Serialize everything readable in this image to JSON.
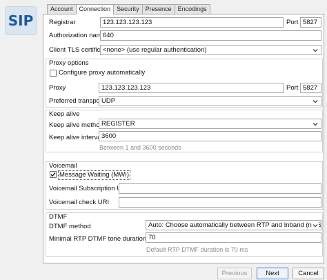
{
  "logo": {
    "text": "SIP"
  },
  "tabs": [
    {
      "label": "Account",
      "active": false
    },
    {
      "label": "Connection",
      "active": true
    },
    {
      "label": "Security",
      "active": false
    },
    {
      "label": "Presence",
      "active": false
    },
    {
      "label": "Encodings",
      "active": false
    }
  ],
  "registrar": {
    "label": "Registrar",
    "value": "123.123.123.123",
    "port_label": "Port",
    "port_value": "5827"
  },
  "auth_name": {
    "label": "Authorization name",
    "value": "640"
  },
  "tls_cert": {
    "label": "Client TLS certificate",
    "value": "<none> (use regular authentication)"
  },
  "proxy_options": {
    "group_label": "Proxy options",
    "configure_label": "Configure proxy automatically",
    "configure_checked": false,
    "proxy_label": "Proxy",
    "proxy_value": "123.123.123.123",
    "port_label": "Port",
    "port_value": "5827",
    "transport_label": "Preferred transport",
    "transport_value": "UDP"
  },
  "keep_alive": {
    "group_label": "Keep alive",
    "method_label": "Keep alive method",
    "method_value": "REGISTER",
    "interval_label": "Keep alive interval",
    "interval_value": "3600",
    "interval_hint": "Between 1 and 3600 seconds"
  },
  "voicemail": {
    "group_label": "Voicemail",
    "mwi_label": "Message Waiting (MWI)",
    "mwi_checked": true,
    "subscription_label": "Voicemail Subscription URI",
    "subscription_value": "",
    "check_label": "Voicemail check URI",
    "check_value": ""
  },
  "dtmf": {
    "group_label": "DTMF",
    "method_label": "DTMF method",
    "method_value": "Auto: Choose automatically between RTP and Inband (no SIP INFO)",
    "min_duration_label": "Minimal RTP DTMF tone duration (ms)",
    "min_duration_value": "70",
    "duration_hint": "Default RTP DTMF duration is 70 ms"
  },
  "buttons": {
    "previous": "Previous",
    "next": "Next",
    "cancel": "Cancel"
  },
  "colors": {
    "accent": "#3b7ad6",
    "logo_text": "#1d5a9c"
  }
}
